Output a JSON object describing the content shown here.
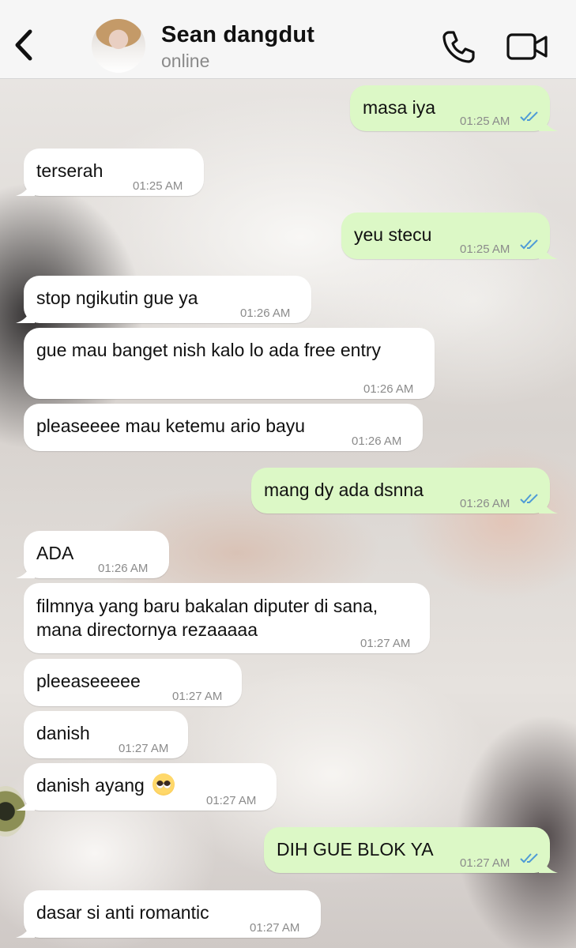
{
  "header": {
    "contact_name": "Sean dangdut",
    "status": "online"
  },
  "messages": [
    {
      "dir": "out",
      "text": "masa iya",
      "time": "01:25 AM",
      "read": true
    },
    {
      "dir": "in",
      "text": "terserah",
      "time": "01:25 AM"
    },
    {
      "dir": "out",
      "text": "yeu stecu",
      "time": "01:25 AM",
      "read": true
    },
    {
      "dir": "in",
      "text": "stop ngikutin gue ya",
      "time": "01:26 AM"
    },
    {
      "dir": "in",
      "text": "gue mau banget nish kalo lo ada free entry",
      "time": "01:26 AM"
    },
    {
      "dir": "in",
      "text": "pleaseeee mau ketemu ario bayu",
      "time": "01:26 AM"
    },
    {
      "dir": "out",
      "text": "mang dy ada dsnna",
      "time": "01:26 AM",
      "read": true
    },
    {
      "dir": "in",
      "text": "ADA",
      "time": "01:26 AM"
    },
    {
      "dir": "in",
      "lines": [
        "filmnya yang baru bakalan diputer di sana,",
        "mana directornya rezaaaaa"
      ],
      "time": "01:27 AM"
    },
    {
      "dir": "in",
      "text": "pleeaseeeee",
      "time": "01:27 AM"
    },
    {
      "dir": "in",
      "text": "danish",
      "time": "01:27 AM"
    },
    {
      "dir": "in",
      "text": "danish ayang",
      "time": "01:27 AM",
      "emoji": "pleading-face"
    },
    {
      "dir": "out",
      "text": "DIH GUE BLOK YA",
      "time": "01:27 AM",
      "read": true
    },
    {
      "dir": "in",
      "text": "dasar si anti romantic",
      "time": "01:27 AM"
    }
  ],
  "icons": {
    "back": "chevron-left-icon",
    "call": "phone-icon",
    "video": "video-camera-icon",
    "read_receipt": "double-check-icon"
  },
  "colors": {
    "incoming_bubble": "#ffffff",
    "outgoing_bubble": "#dcf8c6",
    "read_tick": "#4f9bd6",
    "header_bg": "#f6f6f6"
  }
}
